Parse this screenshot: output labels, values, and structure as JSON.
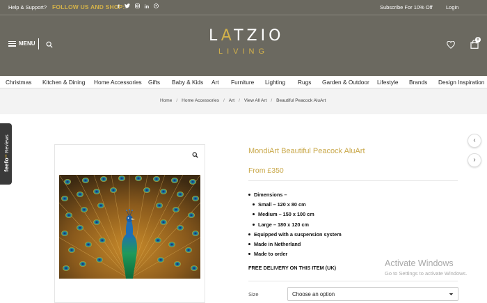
{
  "topbar": {
    "help": "Help & Support?",
    "follow": "FOLLOW US AND SHOP:",
    "social": [
      "f",
      "t",
      "ig",
      "in",
      "p"
    ],
    "subscribe": "Subscribe For 10% Off",
    "login": "Login"
  },
  "header": {
    "menu_label": "MENU",
    "logo_top": "LATZIO",
    "logo_bottom": "LIVING",
    "cart_count": "0"
  },
  "nav": [
    "Christmas",
    "Kitchen & Dining",
    "Home Accessories",
    "Gifts",
    "Baby & Kids",
    "Art",
    "Furniture",
    "Lighting",
    "Rugs",
    "Garden & Outdoor",
    "Lifestyle",
    "Brands",
    "Design Inspiration"
  ],
  "breadcrumb": [
    "Home",
    "Home Accessories",
    "Art",
    "View All Art",
    "Beautiful Peacock AluArt"
  ],
  "feefo": {
    "brand": "feefo",
    "label": "Reviews"
  },
  "product": {
    "title": "MondiArt Beautiful Peacock AluArt",
    "price": "From £350",
    "dimensions_label": "Dimensions –",
    "sizes": [
      "Small – 120 x 80 cm",
      "Medium – 150 x 100 cm",
      "Large – 180 x 120 cm"
    ],
    "features": [
      "Equipped with a suspension system",
      "Made in Netherland",
      "Made to order"
    ],
    "delivery": "FREE DELIVERY ON THIS ITEM (UK)",
    "size_label": "Size",
    "size_select": "Choose an option"
  },
  "watermark": {
    "line1": "Activate Windows",
    "line2": "Go to Settings to activate Windows."
  },
  "colors": {
    "header_bg": "#6b6960",
    "gold": "#c9a84a"
  }
}
